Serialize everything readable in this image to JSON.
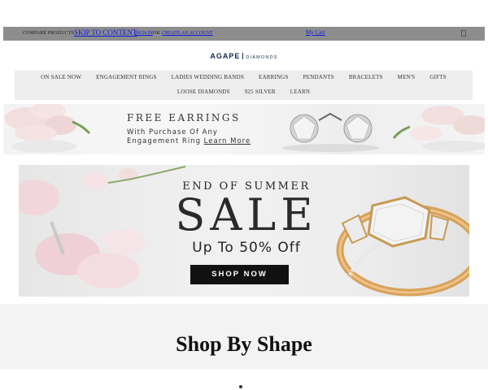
{
  "topbar": {
    "compare_label": "COMPARE PRODUCTS ·",
    "skip_link": "SKIP TO CONTENT",
    "signin": "SIGN IN",
    "or": "OR",
    "create_account": "CREATE AN ACCOUNT",
    "cart": "My Cart",
    "menu_icon": "menu-icon"
  },
  "logo": {
    "brand": "AGAPE",
    "suffix": "DIAMONDS"
  },
  "nav": {
    "row1": [
      "ON SALE NOW",
      "ENGAGEMENT RINGS",
      "LADIES WEDDING BANDS",
      "EARRINGS",
      "PENDANTS",
      "BRACELETS",
      "MEN'S",
      "GIFTS"
    ],
    "row2": [
      "LOOSE DIAMONDS",
      "925 SILVER",
      "LEARN"
    ]
  },
  "promo_banner": {
    "title": "FREE EARRINGS",
    "line1": "With Purchase Of Any",
    "line2": "Engagement Ring",
    "link": "Learn More"
  },
  "sale_banner": {
    "eyebrow": "END OF SUMMER",
    "headline": "SALE",
    "offer": "Up To 50% Off",
    "button": "SHOP NOW"
  },
  "shop_by_shape": {
    "title": "Shop By Shape"
  },
  "colors": {
    "topbar_bg": "#8d8d8d",
    "link_blue": "#0a1adb",
    "brand_navy": "#1a2b52",
    "nav_bg": "#ededed",
    "button_bg": "#111111"
  }
}
